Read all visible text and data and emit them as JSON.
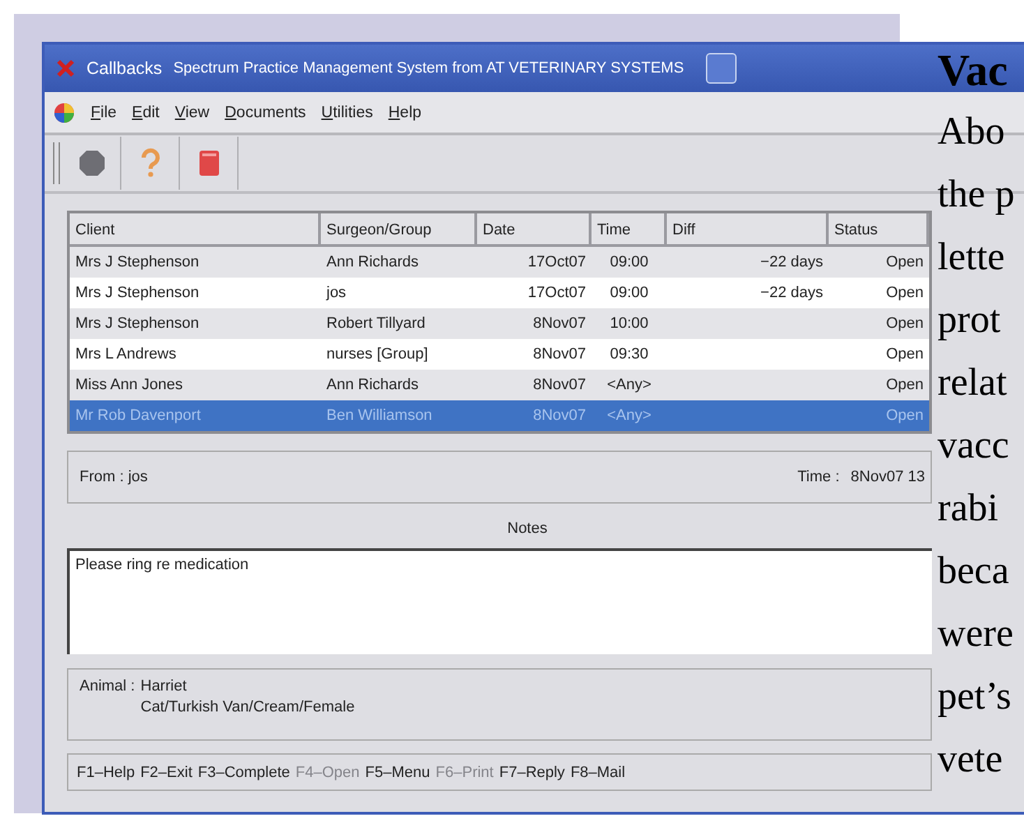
{
  "window": {
    "title_short": "Callbacks",
    "title": "Spectrum Practice Management System from AT VETERINARY SYSTEMS"
  },
  "menu": [
    "File",
    "Edit",
    "View",
    "Documents",
    "Utilities",
    "Help"
  ],
  "toolbar": [
    {
      "kind": "stop"
    },
    {
      "kind": "help"
    },
    {
      "kind": "book"
    }
  ],
  "table": {
    "columns": [
      {
        "label": "Client"
      },
      {
        "label": "Surgeon/Group"
      },
      {
        "label": "Date"
      },
      {
        "label": "Time"
      },
      {
        "label": "Diff"
      },
      {
        "label": "Status"
      }
    ],
    "rows": [
      {
        "cells": [
          "Mrs J Stephenson",
          "Ann Richards",
          "17Oct07",
          "09:00",
          "−22 days",
          "Open"
        ],
        "selected": false
      },
      {
        "cells": [
          "Mrs J Stephenson",
          "jos",
          "17Oct07",
          "09:00",
          "−22 days",
          "Open"
        ],
        "selected": false
      },
      {
        "cells": [
          "Mrs J Stephenson",
          "Robert Tillyard",
          "8Nov07",
          "10:00",
          "",
          "Open"
        ],
        "selected": false
      },
      {
        "cells": [
          "Mrs L Andrews",
          "nurses [Group]",
          "8Nov07",
          "09:30",
          "",
          "Open"
        ],
        "selected": false
      },
      {
        "cells": [
          "Miss Ann Jones",
          "Ann Richards",
          "8Nov07",
          "<Any>",
          "",
          "Open"
        ],
        "selected": false
      },
      {
        "cells": [
          "Mr Rob Davenport",
          "Ben Williamson",
          "8Nov07",
          "<Any>",
          "",
          "Open"
        ],
        "selected": true
      }
    ]
  },
  "from": {
    "label": "From : jos",
    "time_label": "Time :",
    "time": "8Nov07 13"
  },
  "notes": {
    "label": "Notes",
    "value": "Please ring re medication"
  },
  "animal": {
    "label": "Animal :",
    "name": "Harriet",
    "description": "Cat/Turkish Van/Cream/Female"
  },
  "function_keys": [
    {
      "label": "F1–Help",
      "disabled": false
    },
    {
      "label": "F2–Exit",
      "disabled": false
    },
    {
      "label": "F3–Complete",
      "disabled": false
    },
    {
      "label": "F4–Open",
      "disabled": true
    },
    {
      "label": "F5–Menu",
      "disabled": false
    },
    {
      "label": "F6–Print",
      "disabled": true
    },
    {
      "label": "F7–Reply",
      "disabled": false
    },
    {
      "label": "F8–Mail",
      "disabled": false
    }
  ],
  "article": {
    "heading": "Vac",
    "lines": [
      "Abo",
      "the p",
      "lette",
      "prot",
      "relat",
      "vacc",
      "rabi",
      "beca",
      "were",
      "pet’s",
      "vete"
    ]
  }
}
